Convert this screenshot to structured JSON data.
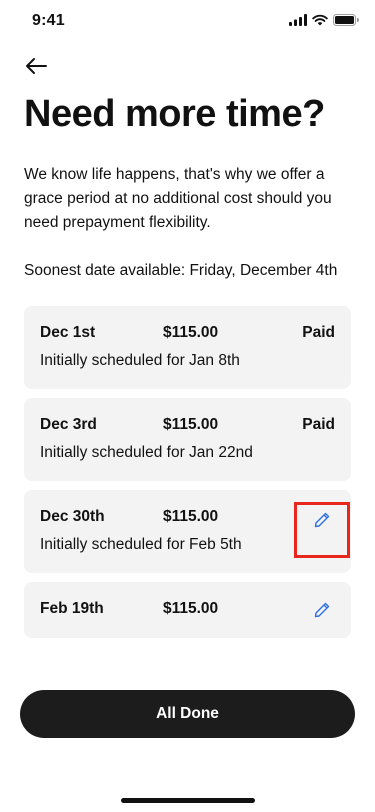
{
  "status_bar": {
    "time": "9:41",
    "icons": [
      "signal-icon",
      "wifi-icon",
      "battery-icon"
    ]
  },
  "header": {
    "back_icon": "arrow-left-icon"
  },
  "page": {
    "title": "Need more time?",
    "intro": "We know life happens, that's why we offer a grace period at no additional cost should you need prepayment flexibility.",
    "soonest": "Soonest date available: Friday, December 4th"
  },
  "payments": [
    {
      "date": "Dec 1st",
      "amount": "$115.00",
      "status": "Paid",
      "note": "Initially scheduled for Jan 8th"
    },
    {
      "date": "Dec 3rd",
      "amount": "$115.00",
      "status": "Paid",
      "note": "Initially scheduled for Jan 22nd"
    },
    {
      "date": "Dec 30th",
      "amount": "$115.00",
      "status": "",
      "note": "Initially scheduled for Feb 5th",
      "action_icon": "pencil-icon",
      "highlighted": true
    },
    {
      "date": "Feb 19th",
      "amount": "$115.00",
      "status": "",
      "note": "",
      "action_icon": "pencil-icon"
    }
  ],
  "footer": {
    "done_label": "All Done"
  },
  "colors": {
    "card_bg": "#f3f3f3",
    "accent_blue": "#2f6fe4",
    "button_bg": "#1c1c1c",
    "highlight": "#e8261c"
  }
}
